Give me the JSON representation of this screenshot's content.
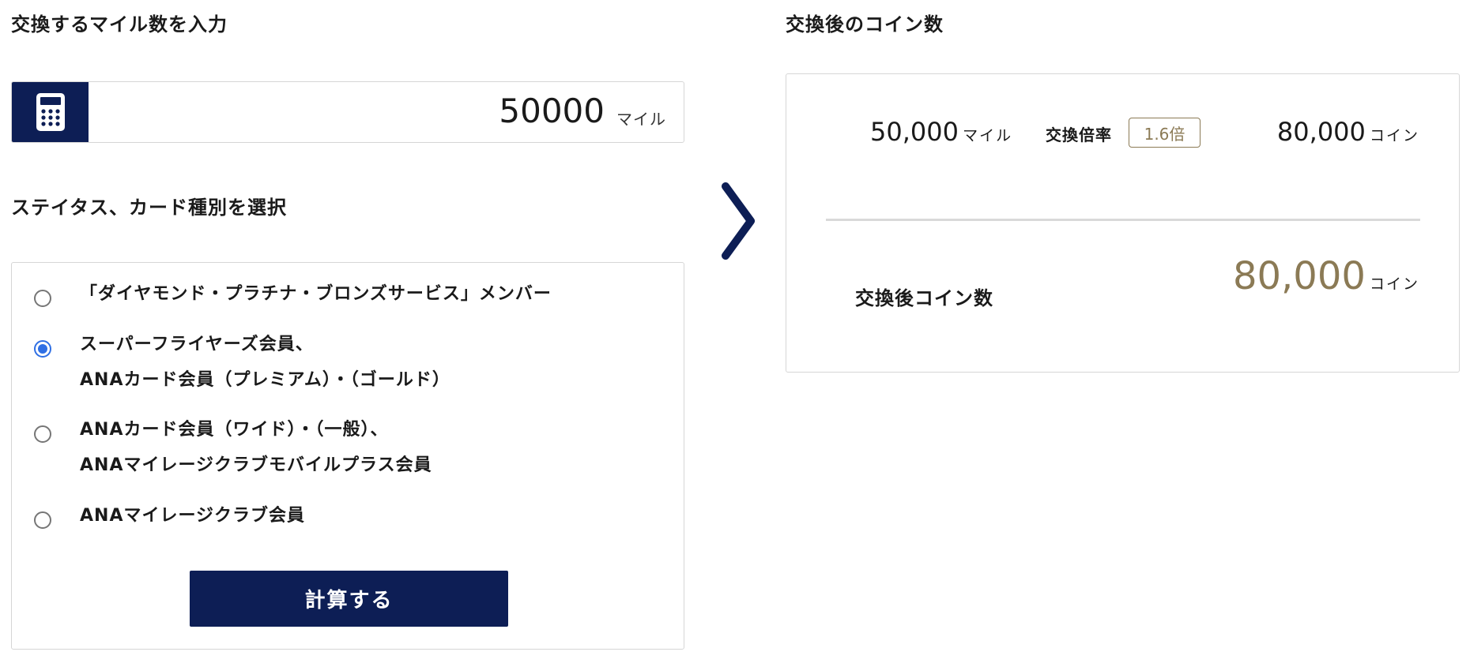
{
  "input_section": {
    "heading": "交換するマイル数を入力",
    "miles_value": "50000",
    "miles_unit": "マイル"
  },
  "status_section": {
    "heading": "ステイタス、カード種別を選択",
    "options": [
      {
        "line1": "「ダイヤモンド・プラチナ・ブロンズサービス」メンバー",
        "line2": "",
        "checked": false
      },
      {
        "line1": "スーパーフライヤーズ会員、",
        "line2": "ANAカード会員（プレミアム）・（ゴールド）",
        "checked": true
      },
      {
        "line1": "ANAカード会員（ワイド）・（一般）、",
        "line2": "ANAマイレージクラブモバイルプラス会員",
        "checked": false
      },
      {
        "line1": "ANAマイレージクラブ会員",
        "line2": "",
        "checked": false
      }
    ],
    "submit_label": "計算する"
  },
  "result_section": {
    "heading": "交換後のコイン数",
    "miles": "50,000",
    "miles_unit": "マイル",
    "rate_label": "交換倍率",
    "rate_value": "1.6倍",
    "coins": "80,000",
    "coins_unit": "コイン",
    "total_label": "交換後コイン数",
    "total_coins": "80,000",
    "total_unit": "コイン"
  },
  "icons": {
    "calculator": "calculator-icon",
    "arrow": "chevron-right-icon"
  },
  "colors": {
    "navy": "#0d1e55",
    "gold": "#8b7a55",
    "radio_blue": "#2f6fe4"
  }
}
